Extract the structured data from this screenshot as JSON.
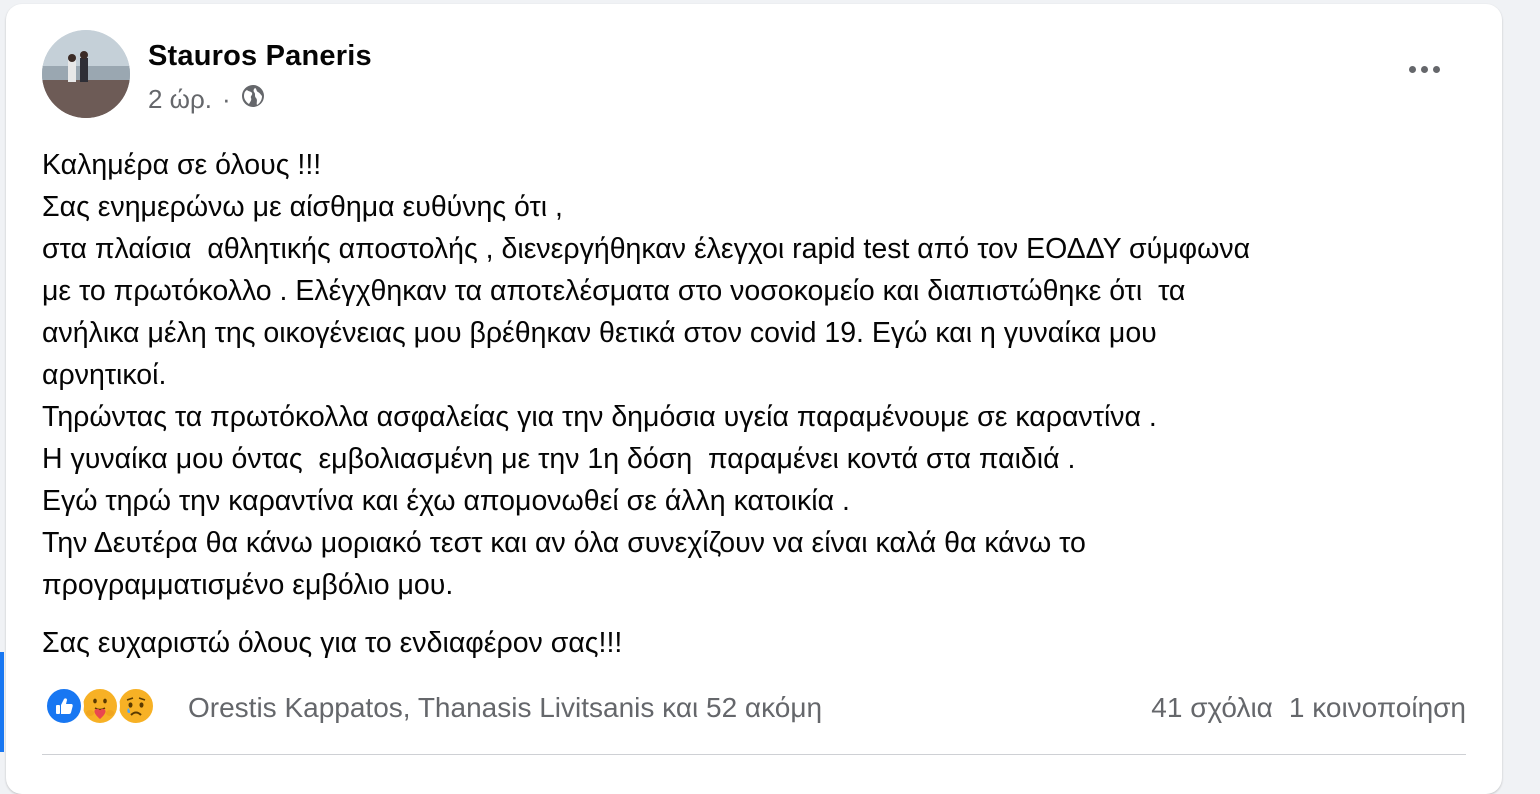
{
  "post": {
    "author": "Stauros Paneris",
    "time": "2 ώρ.",
    "separator": "·",
    "privacy_icon": "globe-icon",
    "menu_icon": "more-horizontal-icon",
    "lines": [
      "Καλημέρα σε όλους !!!",
      "Σας ενημερώνω με αίσθημα ευθύνης ότι ,",
      "στα πλαίσια  αθλητικής αποστολής , διενεργήθηκαν έλεγχοι rapid test από τον ΕΟΔΔΥ σύμφωνα",
      "με το πρωτόκολλο . Ελέγχθηκαν τα αποτελέσματα στο νοσοκομείο και διαπιστώθηκε ότι  τα",
      "ανήλικα μέλη της οικογένειας μου βρέθηκαν θετικά στον covid 19. Εγώ και η γυναίκα μου",
      "αρνητικοί.",
      "Τηρώντας τα πρωτόκολλα ασφαλείας για την δημόσια υγεία παραμένουμε σε καραντίνα .",
      "Η γυναίκα μου όντας  εμβολιασμένη με την 1η δόση  παραμένει κοντά στα παιδιά .",
      "Εγώ τηρώ την καραντίνα και έχω απομονωθεί σε άλλη κατοικία .",
      "Την Δευτέρα θα κάνω μοριακό τεστ και αν όλα συνεχίζουν να είναι καλά θα κάνω το",
      "προγραμματισμένο εμβόλιο μου."
    ],
    "closing": "Σας ευχαριστώ όλους για το ενδιαφέρον σας!!!"
  },
  "reactions": {
    "icons": [
      "like-icon",
      "care-icon",
      "sad-icon"
    ],
    "names": "Orestis Kappatos, Thanasis Livitsanis και 52 ακόμη",
    "comments": "41 σχόλια",
    "shares": "1 κοινοποίηση"
  },
  "colors": {
    "like": "#1877f2",
    "secondary_text": "#65676b",
    "reaction_yellow": "#f7b125"
  }
}
